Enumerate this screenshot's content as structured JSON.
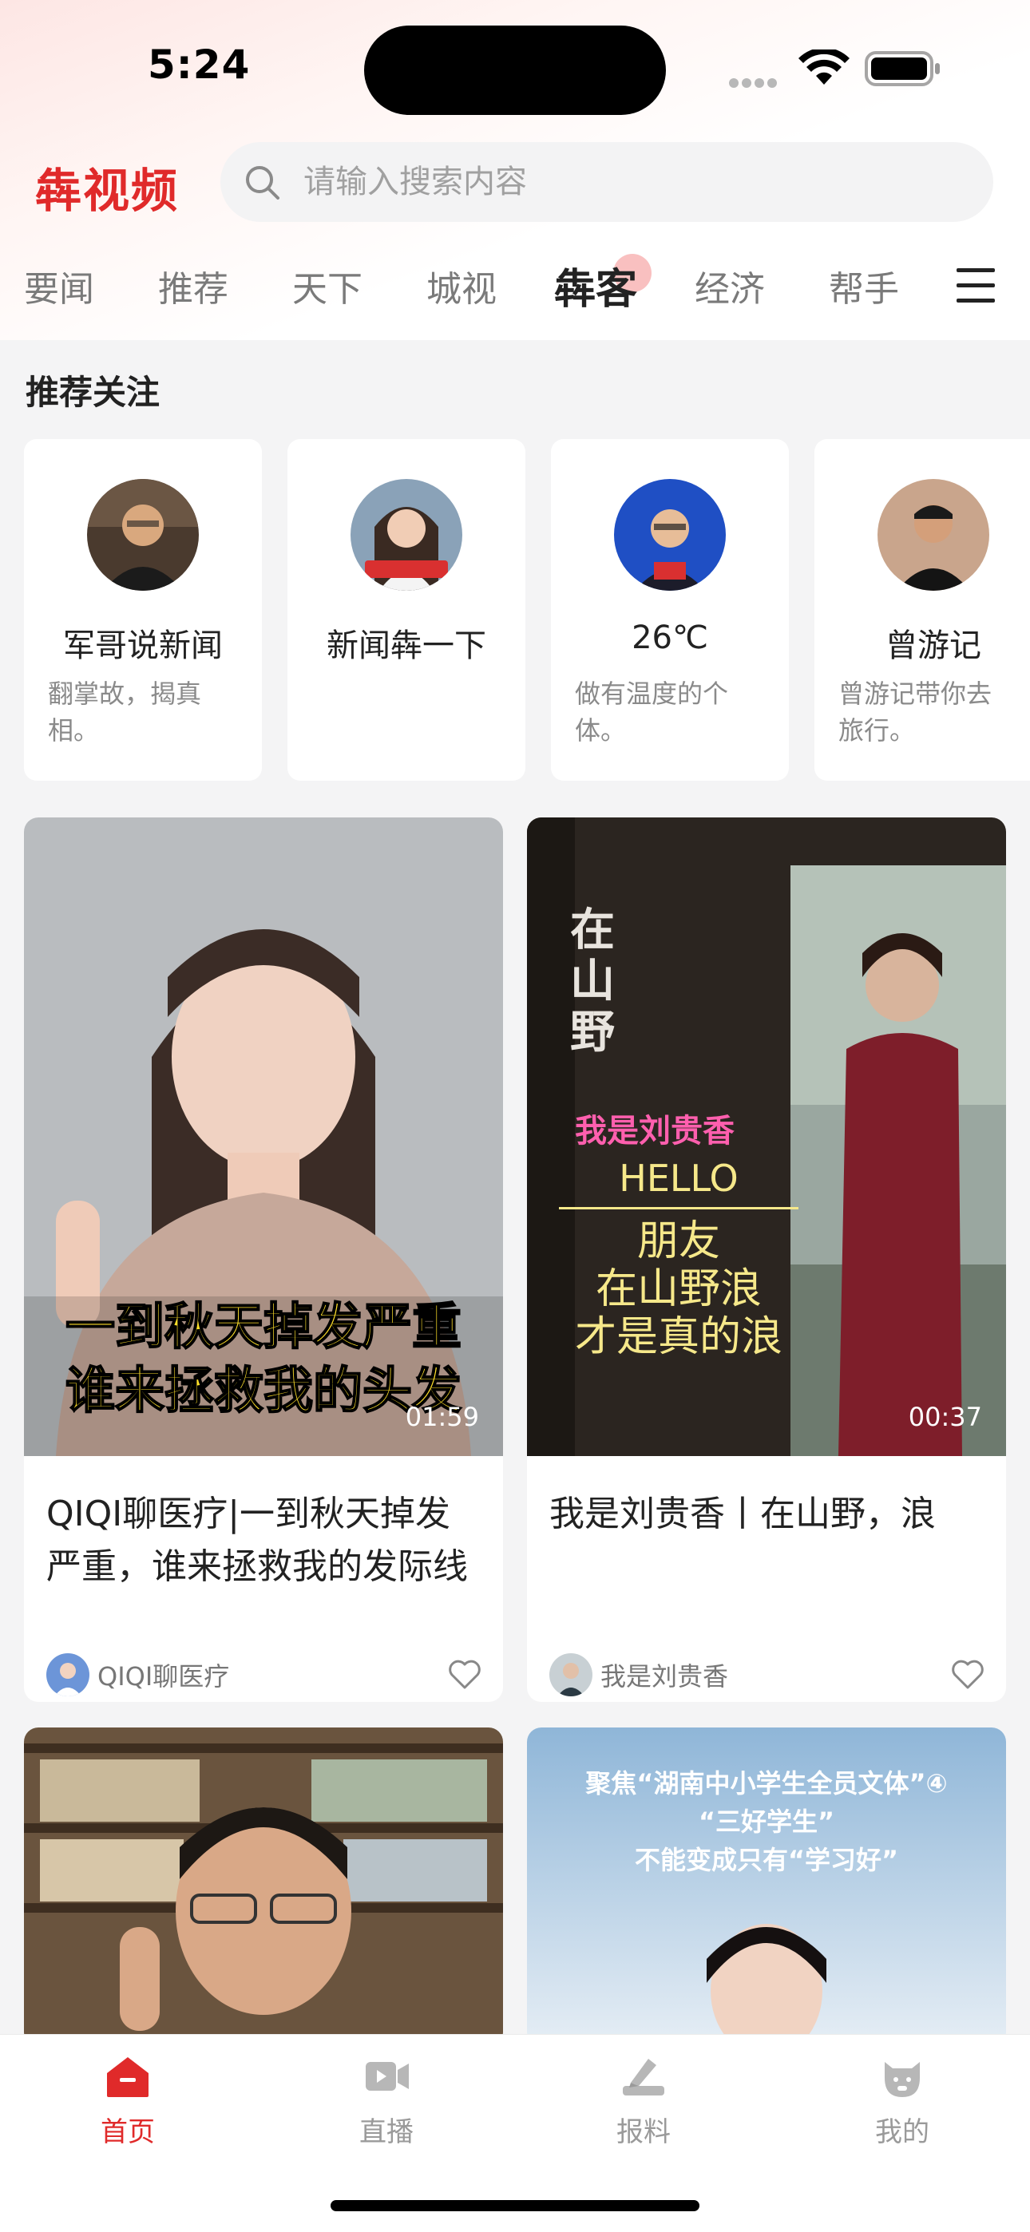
{
  "status_bar": {
    "time": "5:24"
  },
  "app": {
    "logo": "犇视频",
    "accent_color": "#e02a2a"
  },
  "search": {
    "placeholder": "请输入搜索内容"
  },
  "tabs": [
    {
      "label": "要闻"
    },
    {
      "label": "推荐"
    },
    {
      "label": "天下"
    },
    {
      "label": "城视"
    },
    {
      "label": "犇客",
      "active": true
    },
    {
      "label": "经济"
    },
    {
      "label": "帮手"
    }
  ],
  "recommend": {
    "title": "推荐关注",
    "items": [
      {
        "name": "军哥说新闻",
        "desc": "翻掌故，揭真相。"
      },
      {
        "name": "新闻犇一下",
        "desc": ""
      },
      {
        "name": "26℃",
        "desc": "做有温度的个体。"
      },
      {
        "name": "曾游记",
        "desc": "曾游记带你去旅行。"
      }
    ]
  },
  "videos": [
    {
      "title": "QIQI聊医疗|一到秋天掉发严重，谁来拯救我的发际线",
      "duration": "01:59",
      "author": "QIQI聊医疗",
      "caption_line1": "一到秋天掉发严重",
      "caption_line2": "谁来拯救我的头发"
    },
    {
      "title": "我是刘贵香丨在山野，浪",
      "duration": "00:37",
      "author": "我是刘贵香",
      "caption_hello": "HELLO",
      "caption_line1": "朋友",
      "caption_line2": "在山野浪",
      "caption_line3": "才是真的浪",
      "brand": "我是刘贵香",
      "sign": "在山野"
    },
    {
      "title": "",
      "author": ""
    },
    {
      "title": "",
      "author": "",
      "caption_line1": "聚焦“湖南中小学生全员文体”④",
      "caption_line2": "“三好学生”",
      "caption_line3": "不能变成只有“学习好”"
    }
  ],
  "bottom_nav": [
    {
      "label": "首页",
      "icon": "home-icon",
      "active": true
    },
    {
      "label": "直播",
      "icon": "live-video-icon"
    },
    {
      "label": "报料",
      "icon": "report-icon"
    },
    {
      "label": "我的",
      "icon": "profile-icon"
    }
  ]
}
